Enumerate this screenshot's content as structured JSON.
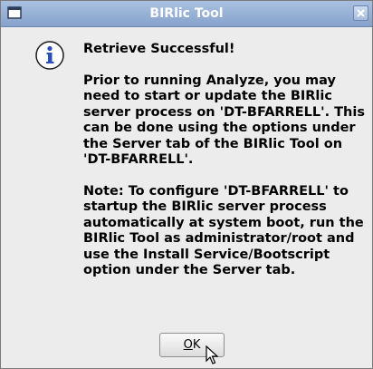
{
  "window": {
    "title": "BIRlic Tool"
  },
  "dialog": {
    "heading": "Retrieve Successful!",
    "message_paragraph_1": "Prior to running Analyze, you may need to start or update the BIRlic server process on 'DT-BFARRELL'. This can be done using the options under the Server tab of the BIRlic Tool on 'DT-BFARRELL'.",
    "message_paragraph_2": "Note: To configure 'DT-BFARRELL' to startup the BIRlic server process automatically at system boot, run the BIRlic Tool as administrator/root and use the Install Service/Bootscript option under the Server tab.",
    "ok_label_mnemonic": "O",
    "ok_label_rest": "K",
    "icon": "info-icon"
  },
  "colors": {
    "titlebar": "#9bb4d9",
    "background": "#ececec",
    "info_icon_fill": "#2a4fb8"
  }
}
